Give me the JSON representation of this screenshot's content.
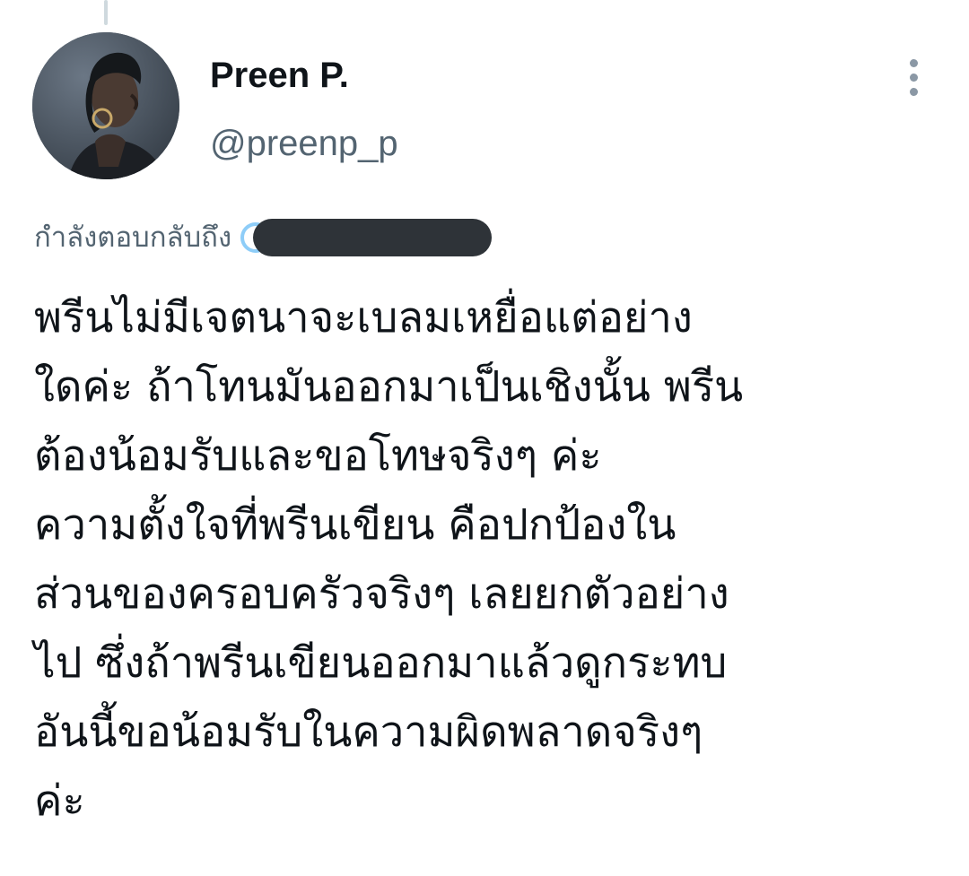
{
  "author": {
    "display_name": "Preen P.",
    "handle": "@preenp_p"
  },
  "reply_context": {
    "prefix": "กำลังตอบกลับถึง",
    "mention_redacted": true
  },
  "tweet": {
    "lines": [
      "พรีนไม่มีเจตนาจะเบลมเหยื่อแต่อย่าง",
      "ใดค่ะ ถ้าโทนมันออกมาเป็นเชิงนั้น พรีน",
      "ต้องน้อมรับและขอโทษจริงๆ ค่ะ",
      "ความตั้งใจที่พรีนเขียน คือปกป้องใน",
      "ส่วนของครอบครัวจริงๆ เลยยกตัวอย่าง",
      "ไป ซึ่งถ้าพรีนเขียนออกมาแล้วดูกระทบ",
      "อันนี้ขอน้อมรับในความผิดพลาดจริงๆ",
      "ค่ะ"
    ]
  },
  "icons": {
    "more": "more-vertical-icon",
    "mention": "at-mention-icon"
  },
  "colors": {
    "text_primary": "#0f1419",
    "text_secondary": "#536471",
    "icon_gray": "#8b98a5",
    "thread_line": "#cfd9de",
    "redaction": "#2e3338",
    "mention_ring": "#8ecdf8"
  }
}
